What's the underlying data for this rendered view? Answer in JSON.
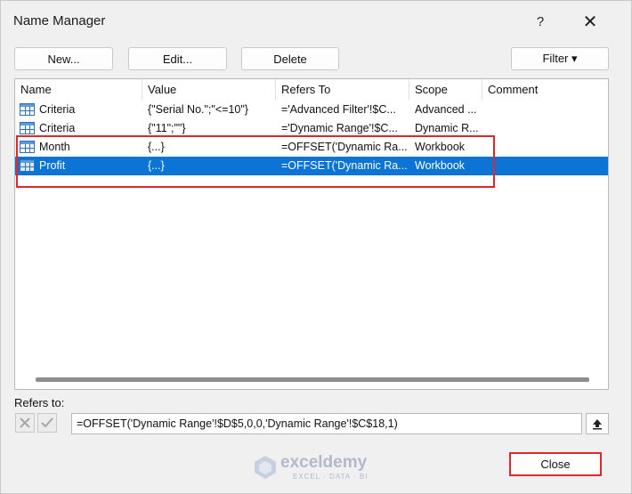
{
  "window": {
    "title": "Name Manager",
    "help_label": "?",
    "close_label": "✕"
  },
  "toolbar": {
    "new_label": "New...",
    "edit_label": "Edit...",
    "delete_label": "Delete",
    "filter_label": "Filter ▾"
  },
  "columns": [
    "Name",
    "Value",
    "Refers To",
    "Scope",
    "Comment"
  ],
  "rows": [
    {
      "name": "Criteria",
      "value": "{\"Serial No.\";\"<=10\"}",
      "refers_to": "='Advanced Filter'!$C...",
      "scope": "Advanced ...",
      "comment": "",
      "selected": false
    },
    {
      "name": "Criteria",
      "value": "{\"11\";\"\"}",
      "refers_to": "='Dynamic Range'!$C...",
      "scope": "Dynamic R...",
      "comment": "",
      "selected": false
    },
    {
      "name": "Month",
      "value": "{...}",
      "refers_to": "=OFFSET('Dynamic Ra...",
      "scope": "Workbook",
      "comment": "",
      "selected": false
    },
    {
      "name": "Profit",
      "value": "{...}",
      "refers_to": "=OFFSET('Dynamic Ra...",
      "scope": "Workbook",
      "comment": "",
      "selected": true
    }
  ],
  "refers_to": {
    "label": "Refers to:",
    "value": "=OFFSET('Dynamic Range'!$D$5,0,0,'Dynamic Range'!$C$18,1)"
  },
  "footer": {
    "close_label": "Close"
  },
  "watermark": {
    "name": "exceldemy",
    "tagline": "EXCEL · DATA · BI"
  },
  "colors": {
    "selection": "#0b74d4",
    "highlight": "#e0282c"
  }
}
